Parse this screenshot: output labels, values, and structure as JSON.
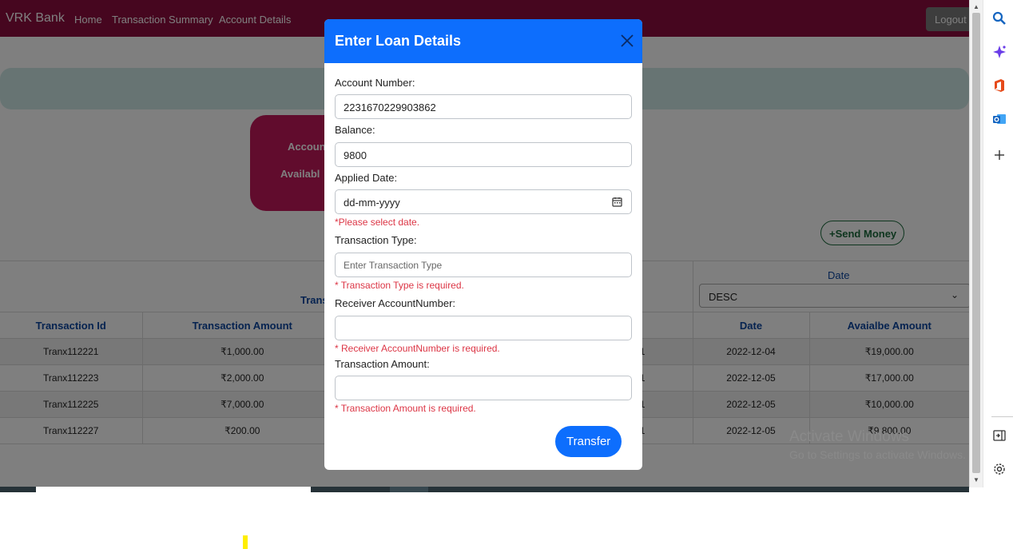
{
  "navbar": {
    "brand": "VRK Bank",
    "links": [
      "Home",
      "Transaction Summary",
      "Account Details"
    ],
    "logout": "Logout"
  },
  "account_card": {
    "line1": "Accoun",
    "line2": "Availabl"
  },
  "send_money": "+Send Money",
  "filters": {
    "trans_label": "Trans",
    "date_label": "Date",
    "sort_value": "DESC"
  },
  "table": {
    "headers": [
      "Transaction Id",
      "Transaction Amount",
      "Date",
      "Avaialbe Amount"
    ],
    "rows": [
      {
        "id": "Tranx112221",
        "amount": "₹1,000.00",
        "hidden": "1",
        "date": "2022-12-04",
        "available": "₹19,000.00"
      },
      {
        "id": "Tranx112223",
        "amount": "₹2,000.00",
        "hidden": "1",
        "date": "2022-12-05",
        "available": "₹17,000.00"
      },
      {
        "id": "Tranx112225",
        "amount": "₹7,000.00",
        "hidden": "1",
        "date": "2022-12-05",
        "available": "₹10,000.00"
      },
      {
        "id": "Tranx112227",
        "amount": "₹200.00",
        "hidden": "1",
        "date": "2022-12-05",
        "available": "₹9,800.00"
      }
    ]
  },
  "watermark": {
    "title": "Activate Windows",
    "subtitle": "Go to Settings to activate Windows."
  },
  "modal": {
    "title": "Enter Loan Details",
    "account_number_label": "Account Number:",
    "account_number_value": "2231670229903862",
    "balance_label": "Balance:",
    "balance_value": "9800",
    "applied_date_label": "Applied Date:",
    "applied_date_placeholder": "dd-mm-yyyy",
    "applied_date_error": "*Please select date.",
    "transaction_type_label": "Transaction Type:",
    "transaction_type_placeholder": "Enter Transaction Type",
    "transaction_type_error": "* Transaction Type is required.",
    "receiver_label": "Receiver AccountNumber:",
    "receiver_error": "* Receiver AccountNumber is required.",
    "amount_label": "Transaction Amount:",
    "amount_error": "* Transaction Amount is required.",
    "transfer_button": "Transfer"
  },
  "colors": {
    "navbar": "#8c0c3f",
    "modal_header": "#0d6efd",
    "error": "#dc3545",
    "table_header_text": "#0d47a1"
  },
  "icons": [
    "search-icon",
    "copilot-icon",
    "office-icon",
    "outlook-icon",
    "plus-icon",
    "sidebar-toggle-icon",
    "settings-icon",
    "close-icon",
    "calendar-icon",
    "chevron-down-icon"
  ]
}
